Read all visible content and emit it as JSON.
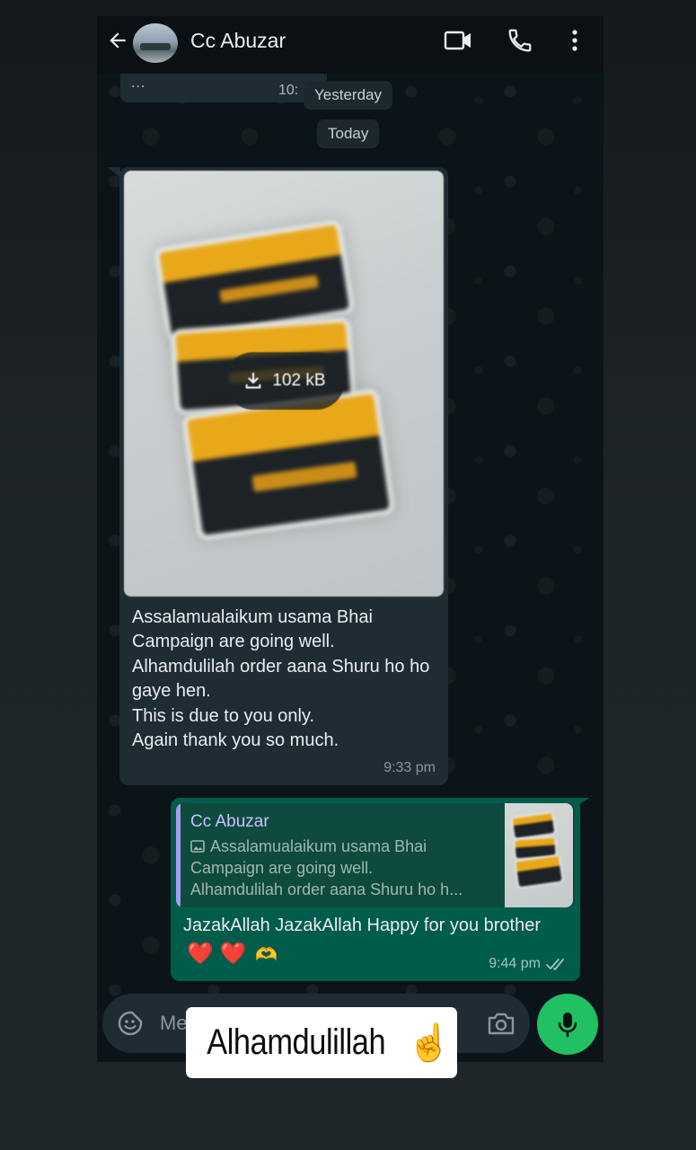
{
  "header": {
    "contact_name": "Cc Abuzar"
  },
  "previous_message": {
    "dots": "...",
    "time": "10:"
  },
  "date_chips": {
    "yesterday": "Yesterday",
    "today": "Today"
  },
  "incoming": {
    "download_size": "102 kB",
    "text": "Assalamualaikum usama Bhai\nCampaign are going well.\nAlhamdulilah order aana Shuru ho ho gaye hen.\nThis is due to you only.\nAgain thank you so much.",
    "time": "9:33 pm"
  },
  "outgoing": {
    "quote_author": "Cc Abuzar",
    "quote_line1": "Assalamualaikum usama Bhai",
    "quote_line2": "Campaign are going well.",
    "quote_line3": "Alhamdulilah order aana Shuru ho h...",
    "text": "JazakAllah JazakAllah Happy for you brother",
    "emoji_hearts": "❤️ ❤️",
    "emoji_hands": "🫶",
    "time": "9:44 pm"
  },
  "input": {
    "placeholder": "Me"
  },
  "overlay": {
    "caption": "Alhamdulillah",
    "emoji": "☝️"
  },
  "colors": {
    "incoming_bubble": "#1f2c33",
    "outgoing_bubble": "#005c4b",
    "accent_green": "#21c063",
    "quote_author": "#c9c1ff"
  },
  "icons": [
    "back-arrow-icon",
    "video-call-icon",
    "phone-call-icon",
    "more-menu-icon",
    "download-icon",
    "image-icon",
    "double-check-icon",
    "sticker-icon",
    "camera-icon",
    "mic-icon"
  ]
}
